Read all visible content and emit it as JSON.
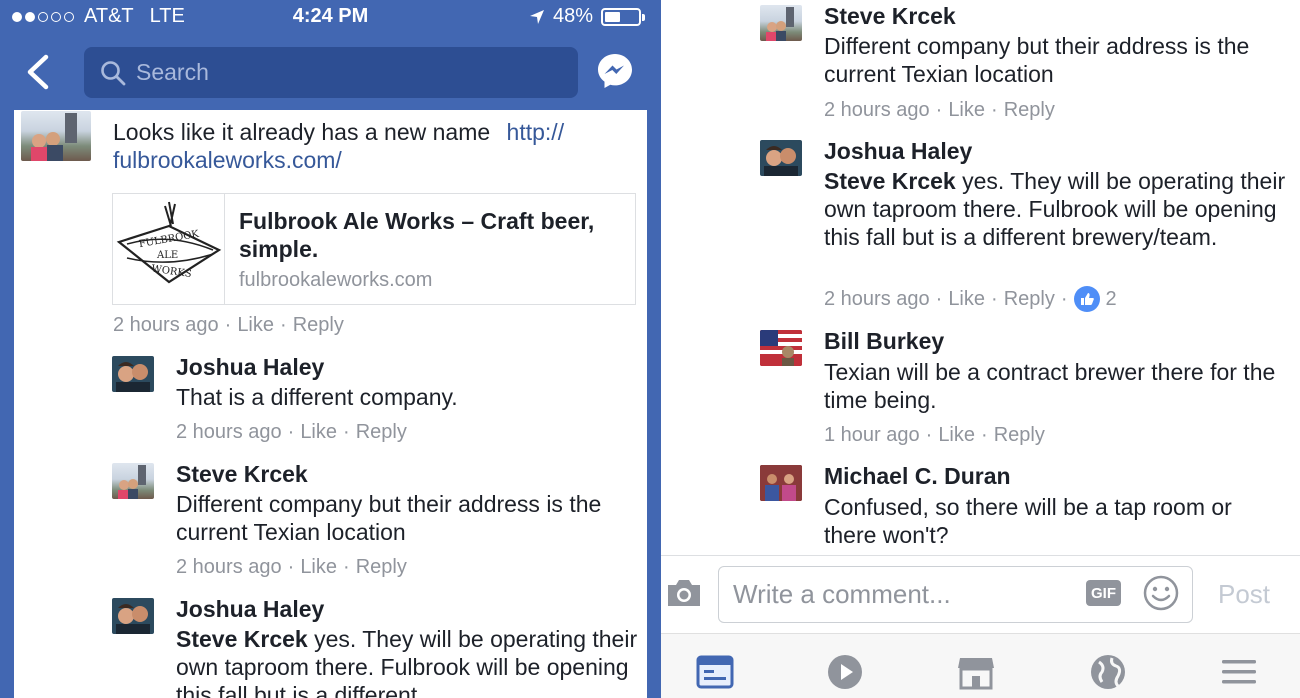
{
  "status": {
    "carrier": "AT&T",
    "network": "LTE",
    "time": "4:24 PM",
    "battery": "48%",
    "battery_level": 0.48
  },
  "nav": {
    "search_placeholder": "Search"
  },
  "left": {
    "top_comment": {
      "text": "Looks like it already has a new name",
      "link_line1": "http://",
      "link_line2": "fulbrookaleworks.com/",
      "preview": {
        "logo_text": "FULBROOK ALE WORKS",
        "title": "Fulbrook Ale Works – Craft beer, simple.",
        "domain": "fulbrookaleworks.com"
      },
      "time": "2 hours ago",
      "like": "Like",
      "reply": "Reply"
    },
    "replies": [
      {
        "name": "Joshua Haley",
        "text": "That is a different company.",
        "time": "2 hours ago",
        "like": "Like",
        "reply": "Reply"
      },
      {
        "name": "Steve Krcek",
        "text": "Different company but their address is the current Texian location",
        "time": "2 hours ago",
        "like": "Like",
        "reply": "Reply"
      },
      {
        "name": "Joshua Haley",
        "mention": "Steve Krcek",
        "text": " yes.  They will be operating their own taproom there.  Fulbrook will be opening this fall but is a different"
      }
    ]
  },
  "right": {
    "replies": [
      {
        "name": "Steve Krcek",
        "text": "Different company but their address is the current Texian location",
        "time": "2 hours ago",
        "like": "Like",
        "reply": "Reply"
      },
      {
        "name": "Joshua Haley",
        "mention": "Steve Krcek",
        "text": " yes.  They will be operating their own taproom there.  Fulbrook will be opening this fall but is a different brewery/team.",
        "time": "2 hours ago",
        "like": "Like",
        "reply": "Reply",
        "reactions": "2"
      },
      {
        "name": "Bill Burkey",
        "text": "Texian will be a contract brewer there for the time being.",
        "time": "1 hour ago",
        "like": "Like",
        "reply": "Reply"
      },
      {
        "name": "Michael C. Duran",
        "text": "Confused, so there will be a tap room or there won't?"
      }
    ],
    "composer": {
      "placeholder": "Write a comment...",
      "gif": "GIF",
      "post": "Post"
    }
  },
  "colors": {
    "brand": "#4267b2",
    "link": "#365899",
    "meta": "#90949c"
  }
}
